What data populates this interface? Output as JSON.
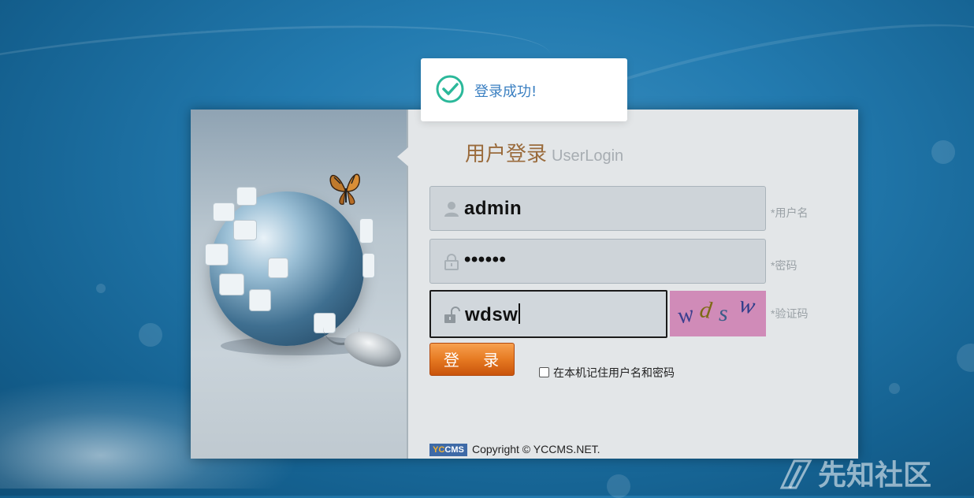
{
  "toast": {
    "message": "登录成功!",
    "icon": "check-circle-icon",
    "icon_color": "#2bb89a"
  },
  "login": {
    "title": "用户登录",
    "title_en": "UserLogin",
    "username": {
      "value": "admin",
      "hint": "*用户名",
      "icon": "user-icon"
    },
    "password": {
      "value": "••••••",
      "hint": "*密码",
      "icon": "lock-icon"
    },
    "captcha": {
      "value": "wdsw",
      "hint": "*验证码",
      "icon": "unlock-icon",
      "image_text": [
        "w",
        "d",
        "s",
        "w"
      ]
    },
    "submit_label": "登 录",
    "remember_label": "在本机记住用户名和密码",
    "remember_checked": false
  },
  "footer": {
    "logo_text": "YCCMS",
    "copyright": "Copyright © YCCMS.NET."
  },
  "watermark": {
    "text": "先知社区"
  },
  "colors": {
    "accent_orange": "#e67a22",
    "title_brown": "#9a6b3c",
    "background_blue": "#237bb0",
    "captcha_bg": "#d08bb8"
  }
}
